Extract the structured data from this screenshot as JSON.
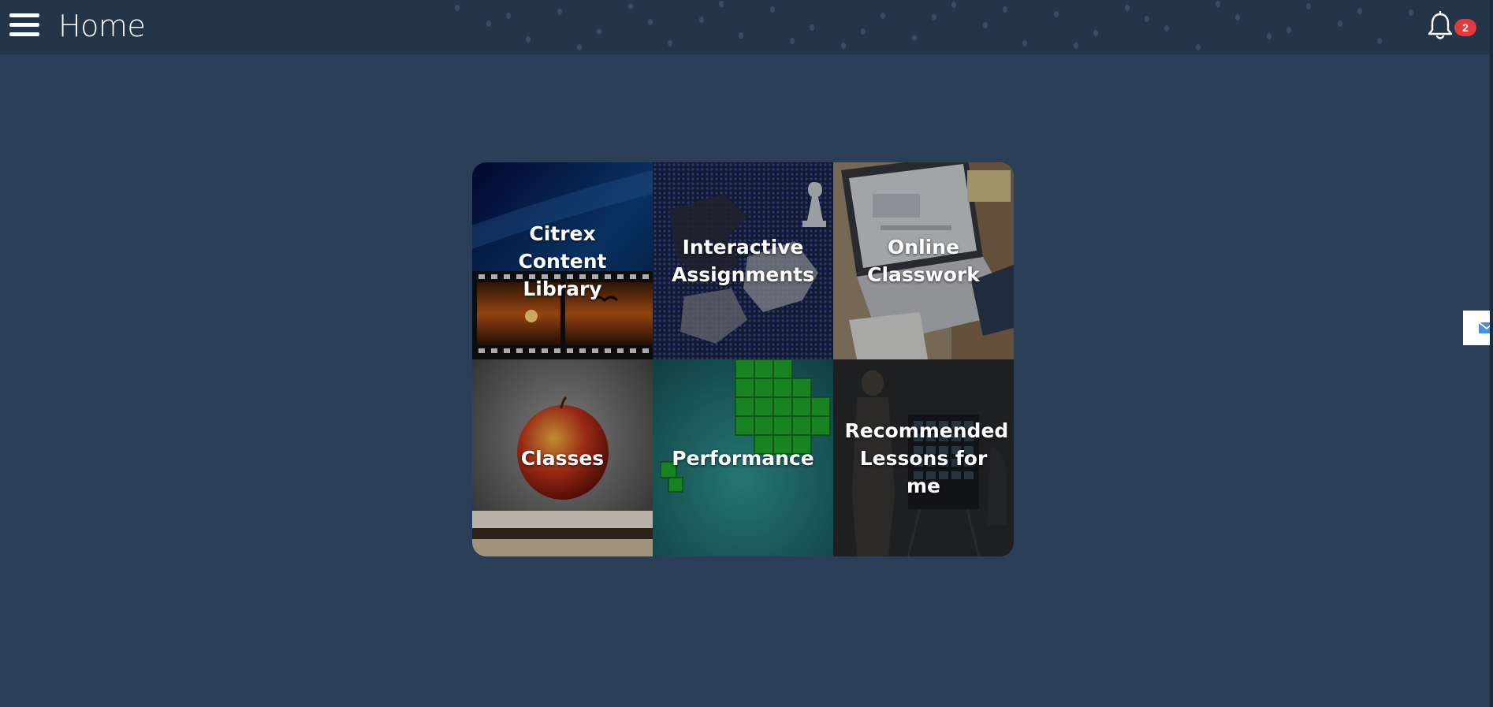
{
  "header": {
    "title": "Home",
    "menu_icon": "hamburger-menu-icon",
    "notifications_icon": "bell-icon",
    "notification_count": "2"
  },
  "tiles": [
    {
      "label": "Citrex Content Library",
      "image": "film-strip-sunset"
    },
    {
      "label": "Interactive Assignments",
      "image": "puzzle-chess"
    },
    {
      "label": "Online Classwork",
      "image": "laptop-desk"
    },
    {
      "label": "Classes",
      "image": "apple-on-books"
    },
    {
      "label": "Performance",
      "image": "green-cubes"
    },
    {
      "label": "Recommended Lessons for me",
      "image": "presenter-board"
    }
  ],
  "side_tab": {
    "icon": "mail-icon"
  },
  "colors": {
    "background": "#2a3f57",
    "header": "#233548",
    "badge": "#e23a3a",
    "mail_icon": "#4a90d9"
  }
}
